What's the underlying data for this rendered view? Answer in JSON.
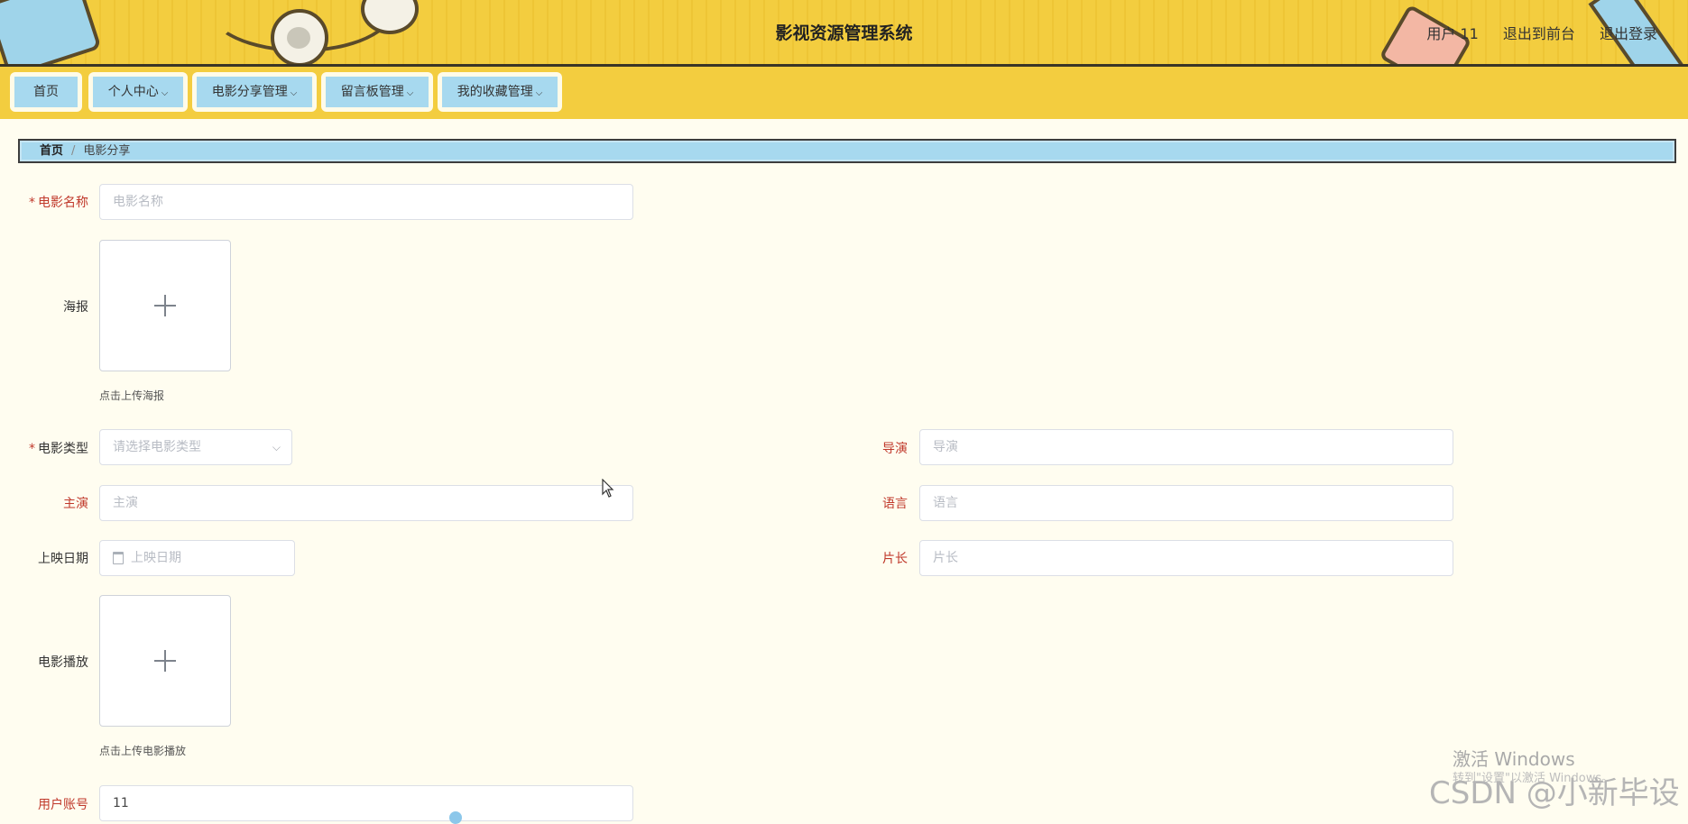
{
  "header": {
    "title": "影视资源管理系统",
    "user": "用户 11",
    "to_front": "退出到前台",
    "logout": "退出登录"
  },
  "nav": {
    "items": [
      {
        "label": "首页"
      },
      {
        "label": "个人中心"
      },
      {
        "label": "电影分享管理"
      },
      {
        "label": "留言板管理"
      },
      {
        "label": "我的收藏管理"
      }
    ]
  },
  "breadcrumb": {
    "home": "首页",
    "separator": "/",
    "current": "电影分享"
  },
  "form": {
    "movie_name": {
      "label": "电影名称",
      "placeholder": "电影名称"
    },
    "poster": {
      "label": "海报",
      "hint": "点击上传海报"
    },
    "movie_type": {
      "label": "电影类型",
      "placeholder": "请选择电影类型"
    },
    "director": {
      "label": "导演",
      "placeholder": "导演"
    },
    "lead_actor": {
      "label": "主演",
      "placeholder": "主演"
    },
    "language": {
      "label": "语言",
      "placeholder": "语言"
    },
    "release_date": {
      "label": "上映日期",
      "placeholder": "上映日期"
    },
    "duration": {
      "label": "片长",
      "placeholder": "片长"
    },
    "movie_play": {
      "label": "电影播放",
      "hint": "点击上传电影播放"
    },
    "user_account": {
      "label": "用户账号",
      "value": "11"
    }
  },
  "watermark": {
    "activate": "激活 Windows",
    "activate_sub": "转到\"设置\"以激活 Windows。",
    "csdn": "CSDN @小新毕设"
  }
}
